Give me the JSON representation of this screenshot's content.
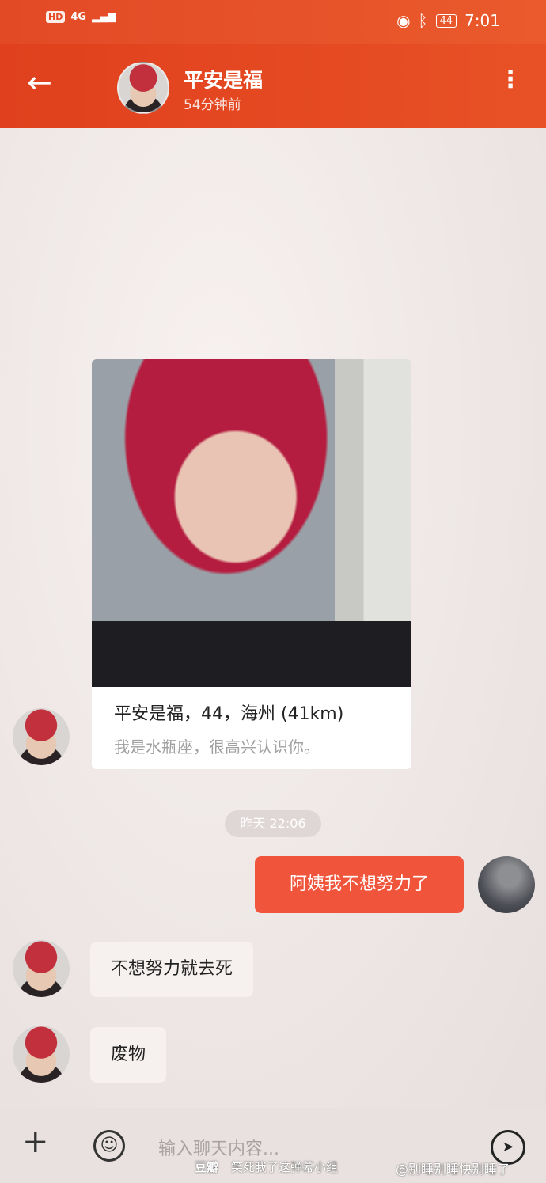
{
  "status_bar": {
    "left_chips": [
      "HD",
      "4G"
    ],
    "battery": "44",
    "time": "7:01"
  },
  "header": {
    "back_icon": "arrow-left-icon",
    "contact_name": "平安是福",
    "last_seen": "54分钟前",
    "more_icon": "more-vertical-icon"
  },
  "profile_card": {
    "name_line": "平安是福，44，海州 (41km)",
    "bio": "我是水瓶座，很高兴认识你。"
  },
  "timestamp": "昨天 22:06",
  "messages": [
    {
      "side": "right",
      "text": "阿姨我不想努力了"
    },
    {
      "side": "left",
      "text": "不想努力就去死"
    },
    {
      "side": "left",
      "text": "废物"
    }
  ],
  "input_bar": {
    "placeholder": "输入聊天内容...",
    "plus_icon": "plus-icon",
    "emoji_icon": "emoji-icon",
    "send_icon": "send-icon"
  },
  "watermarks": {
    "douban": "豆瓣",
    "caption": "笑死我了这弹幕小组",
    "weibo": "@别睡别睡快别睡了"
  },
  "colors": {
    "header": "#e0401d",
    "outgoing_bubble": "#f0553c",
    "incoming_bubble": "#f6f1ef"
  }
}
